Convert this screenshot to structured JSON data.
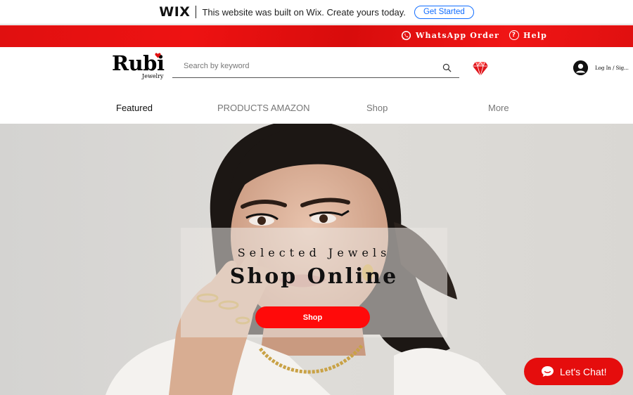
{
  "wix_bar": {
    "logo": "WIX",
    "message": "This website was built on Wix. Create yours today.",
    "cta": "Get Started"
  },
  "top_bar": {
    "whatsapp": "WhatsApp Order",
    "help": "Help",
    "help_icon": "?",
    "background": "#e50d0d"
  },
  "header": {
    "logo_name": "Rubi",
    "logo_tagline": "Jewelry",
    "search_placeholder": "Search by keyword",
    "login": "Log In / Sig..."
  },
  "nav": {
    "items": [
      "Featured",
      "PRODUCTS AMAZON",
      "Shop",
      "More"
    ],
    "active": "Featured"
  },
  "hero": {
    "subtitle": "Selected Jewels",
    "title": "Shop Online",
    "button": "Shop",
    "button_color": "#ff0a0a"
  },
  "chat": {
    "label": "Let's Chat!"
  },
  "icons": [
    "whatsapp-icon",
    "help-icon",
    "search-icon",
    "gem-icon",
    "avatar-icon",
    "chat-icon"
  ]
}
